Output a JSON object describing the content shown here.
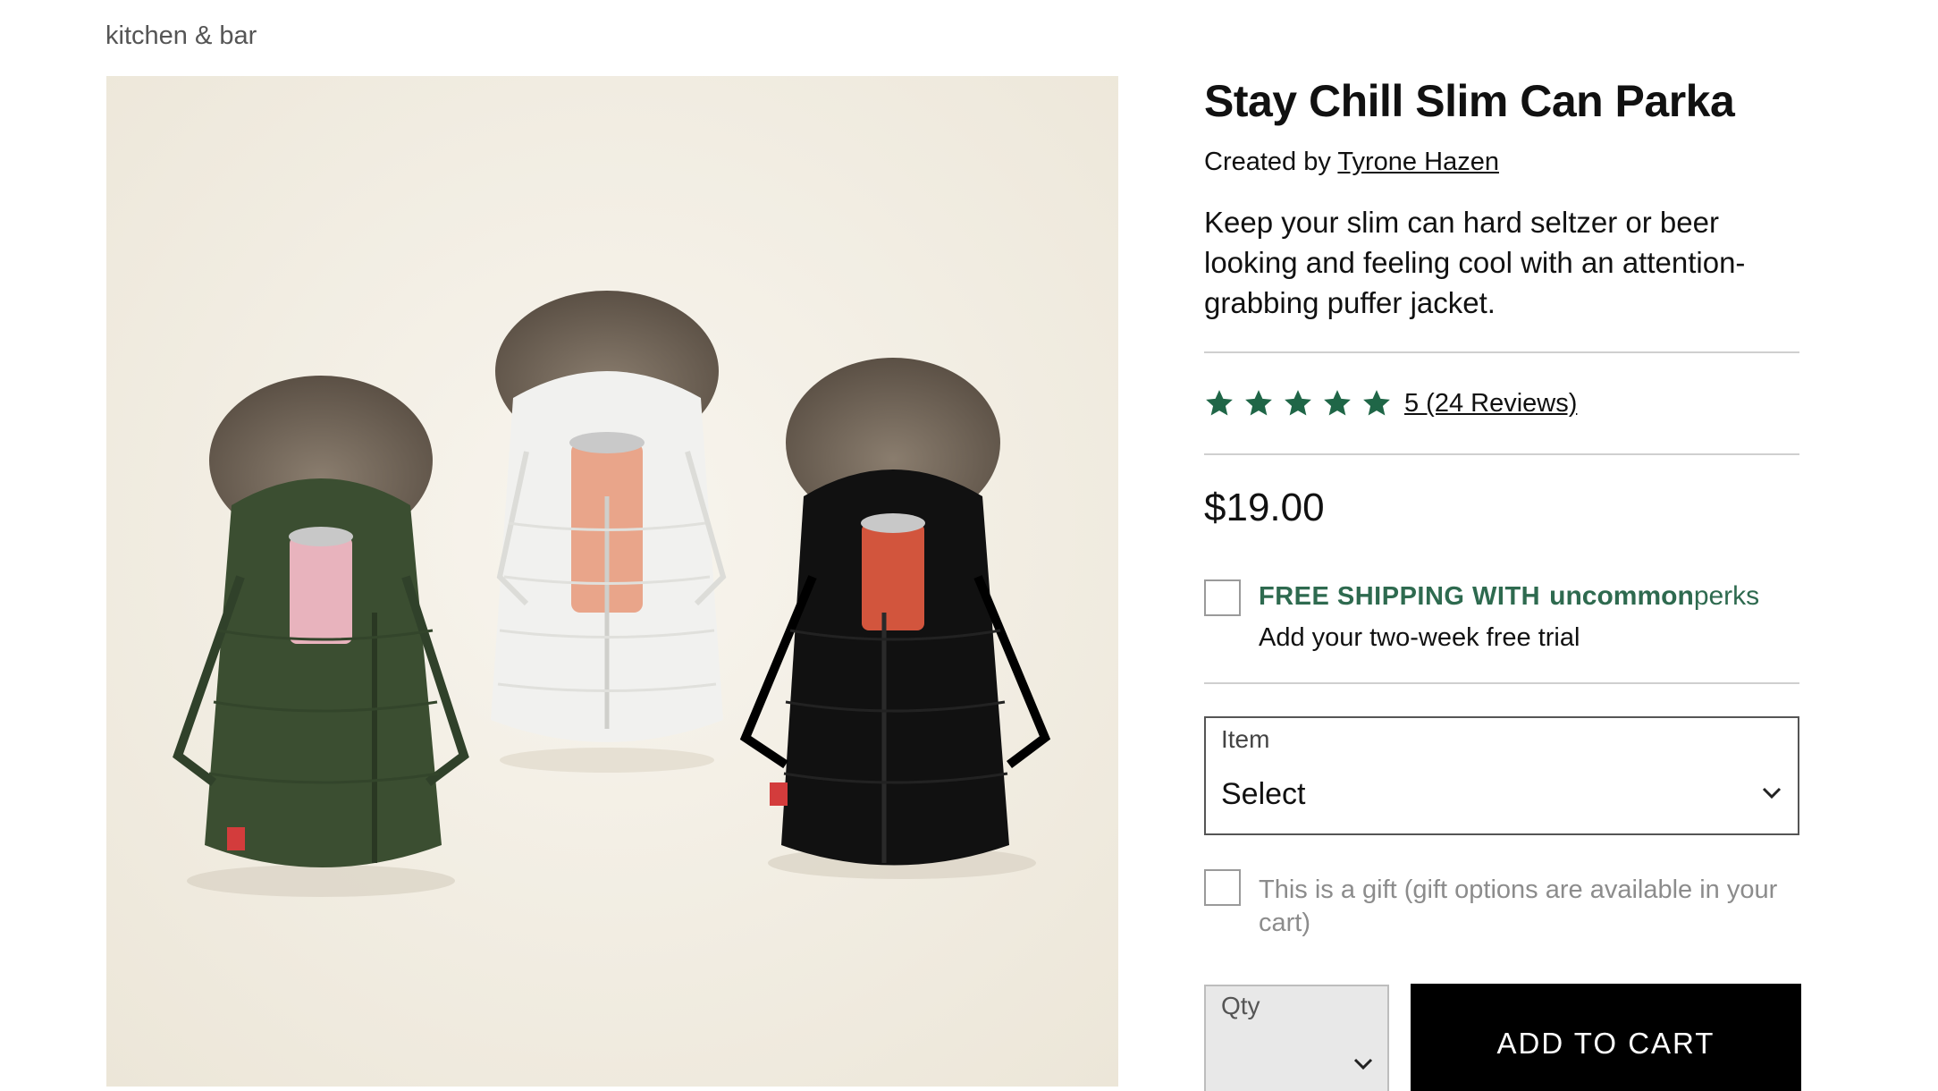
{
  "breadcrumb": "kitchen & bar",
  "product": {
    "image_alt": "Three puffer-jacket can coolers in green, white and black",
    "title": "Stay Chill Slim Can Parka",
    "created_by_prefix": "Created by",
    "creator_name": "Tyrone Hazen",
    "description": "Keep your slim can hard seltzer or beer looking and feeling cool with an attention-grabbing puffer jacket.",
    "rating": {
      "stars": 5,
      "link_text": "5 (24 Reviews)"
    },
    "price": "$19.00"
  },
  "perks": {
    "label": "FREE SHIPPING WITH",
    "brand_bold": "uncommon",
    "brand_light": "perks",
    "subtext": "Add your two-week free trial",
    "checked": false
  },
  "item_select": {
    "label": "Item",
    "value": "Select"
  },
  "gift": {
    "text": "This is a gift (gift options are available in your cart)",
    "checked": false
  },
  "qty": {
    "label": "Qty",
    "value": ""
  },
  "add_to_cart": "ADD TO CART",
  "colors": {
    "accent_green": "#2e6a4f",
    "star_green": "#1f6647",
    "button_black": "#000000"
  }
}
